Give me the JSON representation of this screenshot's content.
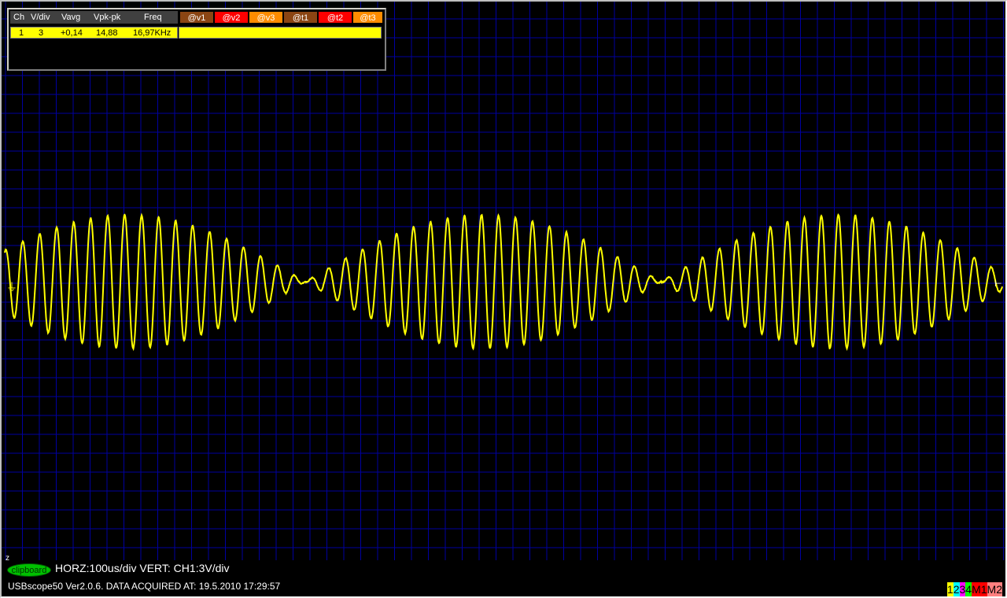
{
  "measure": {
    "headers": {
      "ch": "Ch",
      "vdiv": "V/div",
      "vavg": "Vavg",
      "vpkpk": "Vpk-pk",
      "freq": "Freq"
    },
    "buttons": [
      {
        "label": "@v1",
        "color": "#8b4513"
      },
      {
        "label": "@v2",
        "color": "#ff0000"
      },
      {
        "label": "@v3",
        "color": "#ff8c00"
      },
      {
        "label": "@t1",
        "color": "#8b4513"
      },
      {
        "label": "@t2",
        "color": "#ff0000"
      },
      {
        "label": "@t3",
        "color": "#ff8c00"
      }
    ],
    "row": {
      "ch": "1",
      "vdiv": "3",
      "vavg": "+0,14",
      "vpkpk": "14,88",
      "freq": "16,97KHz"
    }
  },
  "footer": {
    "clipboard": "clipboard",
    "horz": "HORZ:100us/div VERT: CH1:3V/div",
    "status": "USBscope50 Ver2.0.6.  DATA ACQUIRED AT: 19.5.2010 17:29:57",
    "legend": [
      {
        "label": "1",
        "bg": "#ffff00",
        "fg": "#000"
      },
      {
        "label": "2",
        "bg": "#00ffff",
        "fg": "#000"
      },
      {
        "label": "3",
        "bg": "#ff00ff",
        "fg": "#000"
      },
      {
        "label": "4",
        "bg": "#00ff00",
        "fg": "#000"
      },
      {
        "label": "M1",
        "bg": "#ff0000",
        "fg": "#000"
      },
      {
        "label": "M2",
        "bg": "#ff8080",
        "fg": "#000"
      }
    ]
  },
  "colors": {
    "grid": "#0000a0",
    "trace": "#ffff00",
    "background": "#000000"
  },
  "chart_data": {
    "type": "line",
    "title": "",
    "xlabel": "",
    "ylabel": "",
    "series": [
      {
        "signal": "amplitude-modulated sine",
        "carrier_frequency_khz": 16.97,
        "peak_to_peak_v": 14.88,
        "average_v": 0.14,
        "volts_per_div": 3,
        "time_per_div_us": 100
      }
    ],
    "grid": true
  }
}
